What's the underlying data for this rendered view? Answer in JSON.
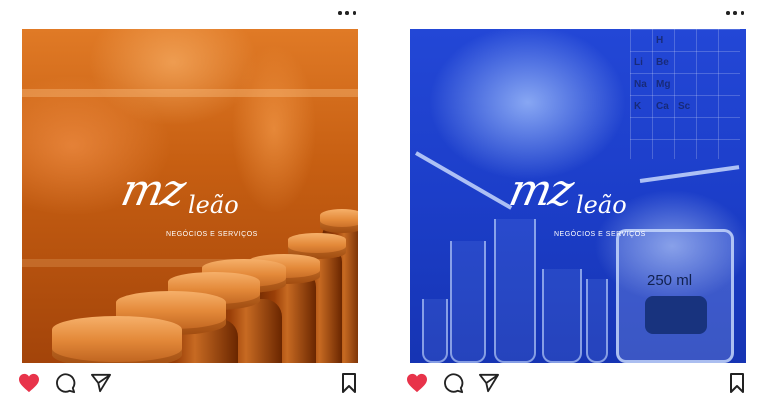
{
  "colors": {
    "like": "#e8334a",
    "icon": "#222222",
    "orange_bg": "#c75f12",
    "blue_bg": "#1c3ec9"
  },
  "posts": [
    {
      "logo": {
        "mark": "mz",
        "name": "leão",
        "tagline": "NEGÓCIOS E SERVIÇOS"
      },
      "actions": {
        "like": "heart-icon",
        "comment": "comment-icon",
        "share": "send-icon",
        "save": "bookmark-icon"
      },
      "liked": true
    },
    {
      "logo": {
        "mark": "mz",
        "name": "leão",
        "tagline": "NEGÓCIOS E SERVIÇOS"
      },
      "labels": {
        "beaker": "250 ml",
        "elements": [
          "H",
          "Li",
          "Na",
          "Be",
          "Mg",
          "Ca",
          "Sc",
          "K"
        ]
      },
      "actions": {
        "like": "heart-icon",
        "comment": "comment-icon",
        "share": "send-icon",
        "save": "bookmark-icon"
      },
      "liked": true
    }
  ]
}
